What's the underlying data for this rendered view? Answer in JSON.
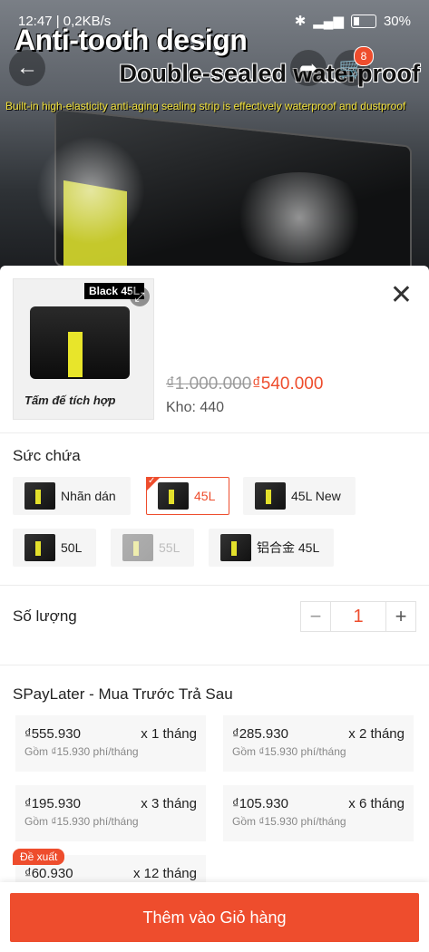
{
  "status": {
    "time": "12:47",
    "speed": "0,2KB/s",
    "battery": "30%"
  },
  "banner": {
    "line1": "Anti-tooth design",
    "line2": "Double-sealed waterproof",
    "line3": "Built-in high-elasticity anti-aging sealing strip is effectively waterproof and dustproof",
    "cart_count": "8"
  },
  "product": {
    "thumb_label": "Black 45L",
    "thumb_caption": "Tấm đế tích hợp",
    "price_old": "₫1.000.000",
    "price_new": "₫540.000",
    "stock": "Kho: 440"
  },
  "capacity": {
    "title": "Sức chứa",
    "options": [
      {
        "label": "Nhãn dán",
        "state": "normal"
      },
      {
        "label": "45L",
        "state": "selected"
      },
      {
        "label": "45L New",
        "state": "normal"
      },
      {
        "label": "50L",
        "state": "normal"
      },
      {
        "label": "55L",
        "state": "disabled"
      },
      {
        "label": "铝合金 45L",
        "state": "normal"
      }
    ]
  },
  "quantity": {
    "title": "Số lượng",
    "minus": "−",
    "value": "1",
    "plus": "+"
  },
  "spaylater": {
    "title": "SPayLater - Mua Trước Trả Sau",
    "badge": "Đề xuất",
    "plans": [
      {
        "amount": "₫555.930",
        "term": "x 1 tháng",
        "fee": "Gồm ₫15.930 phí/tháng"
      },
      {
        "amount": "₫285.930",
        "term": "x 2 tháng",
        "fee": "Gồm ₫15.930 phí/tháng"
      },
      {
        "amount": "₫195.930",
        "term": "x 3 tháng",
        "fee": "Gồm ₫15.930 phí/tháng"
      },
      {
        "amount": "₫105.930",
        "term": "x 6 tháng",
        "fee": "Gồm ₫15.930 phí/tháng"
      },
      {
        "amount": "₫60.930",
        "term": "x 12 tháng",
        "fee": ""
      }
    ]
  },
  "footer": {
    "add_to_cart": "Thêm vào Giỏ hàng"
  },
  "colors": {
    "accent": "#ee4d2d"
  }
}
